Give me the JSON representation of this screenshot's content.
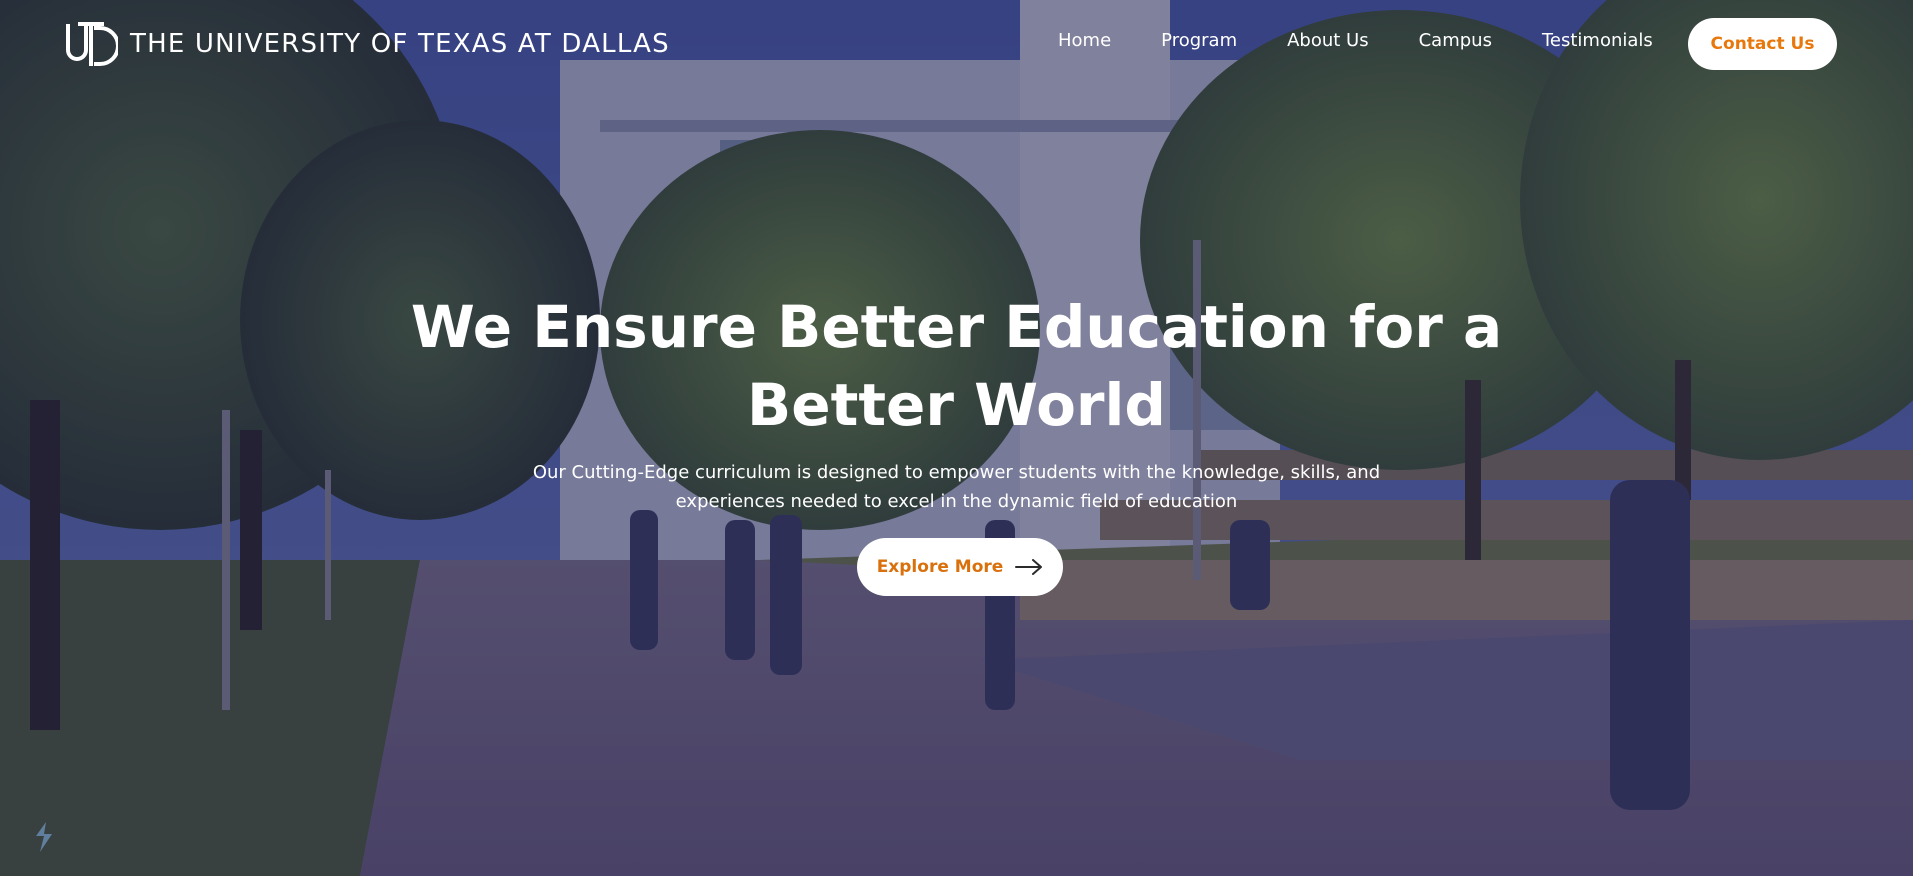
{
  "brand": {
    "name": "THE UNIVERSITY OF TEXAS AT DALLAS",
    "logo_icon": "utd-monogram-icon"
  },
  "nav": {
    "links": [
      {
        "label": "Home"
      },
      {
        "label": "Program"
      },
      {
        "label": "About Us"
      },
      {
        "label": "Campus"
      },
      {
        "label": "Testimonials"
      }
    ],
    "cta_label": "Contact Us"
  },
  "hero": {
    "title_line1": "We Ensure Better Education for a",
    "title_line2": "Better World",
    "subtitle_line1": "Our Cutting-Edge curriculum is designed to empower students with the knowledge, skills, and",
    "subtitle_line2": "experiences needed to excel in the dynamic field of education",
    "button_label": "Explore More",
    "button_icon": "arrow-right-icon"
  },
  "colors": {
    "accent": "#e8780c",
    "overlay": "#1c1a4e",
    "text": "#ffffff"
  }
}
